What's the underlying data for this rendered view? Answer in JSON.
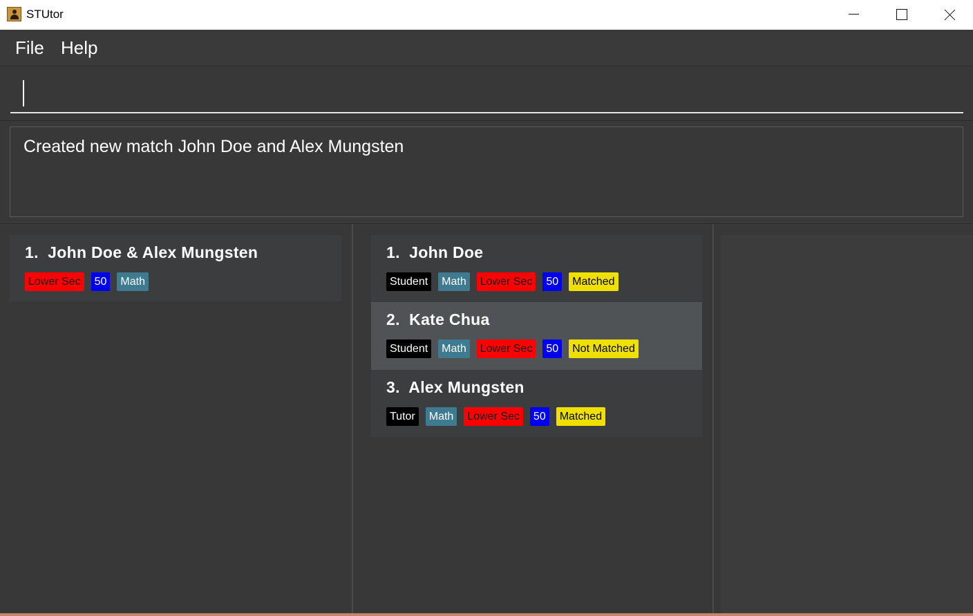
{
  "window": {
    "title": "STUtor",
    "icon": "person-icon",
    "controls": [
      "minimize-icon",
      "maximize-icon",
      "close-icon"
    ]
  },
  "menu": {
    "file": "File",
    "help": "Help"
  },
  "command": {
    "value": "",
    "placeholder": ""
  },
  "result": {
    "message": "Created new match John Doe and Alex Mungsten"
  },
  "matches": [
    {
      "title": "1.  John Doe & Alex Mungsten",
      "level": "Lower Sec",
      "price": "50",
      "subject": "Math"
    }
  ],
  "people": [
    {
      "title": "1.  John Doe",
      "role": "Student",
      "subject": "Math",
      "level": "Lower Sec",
      "price": "50",
      "status": "Matched",
      "selected": false
    },
    {
      "title": "2.  Kate Chua",
      "role": "Student",
      "subject": "Math",
      "level": "Lower Sec",
      "price": "50",
      "status": "Not Matched",
      "selected": true
    },
    {
      "title": "3.  Alex Mungsten",
      "role": "Tutor",
      "subject": "Math",
      "level": "Lower Sec",
      "price": "50",
      "status": "Matched",
      "selected": false
    }
  ],
  "colors": {
    "level_tag": "#ff0000",
    "price_tag": "#0000f0",
    "subject_tag": "#3e7b91",
    "role_tag": "#000000",
    "status_tag": "#f0e000",
    "background": "#383838"
  }
}
